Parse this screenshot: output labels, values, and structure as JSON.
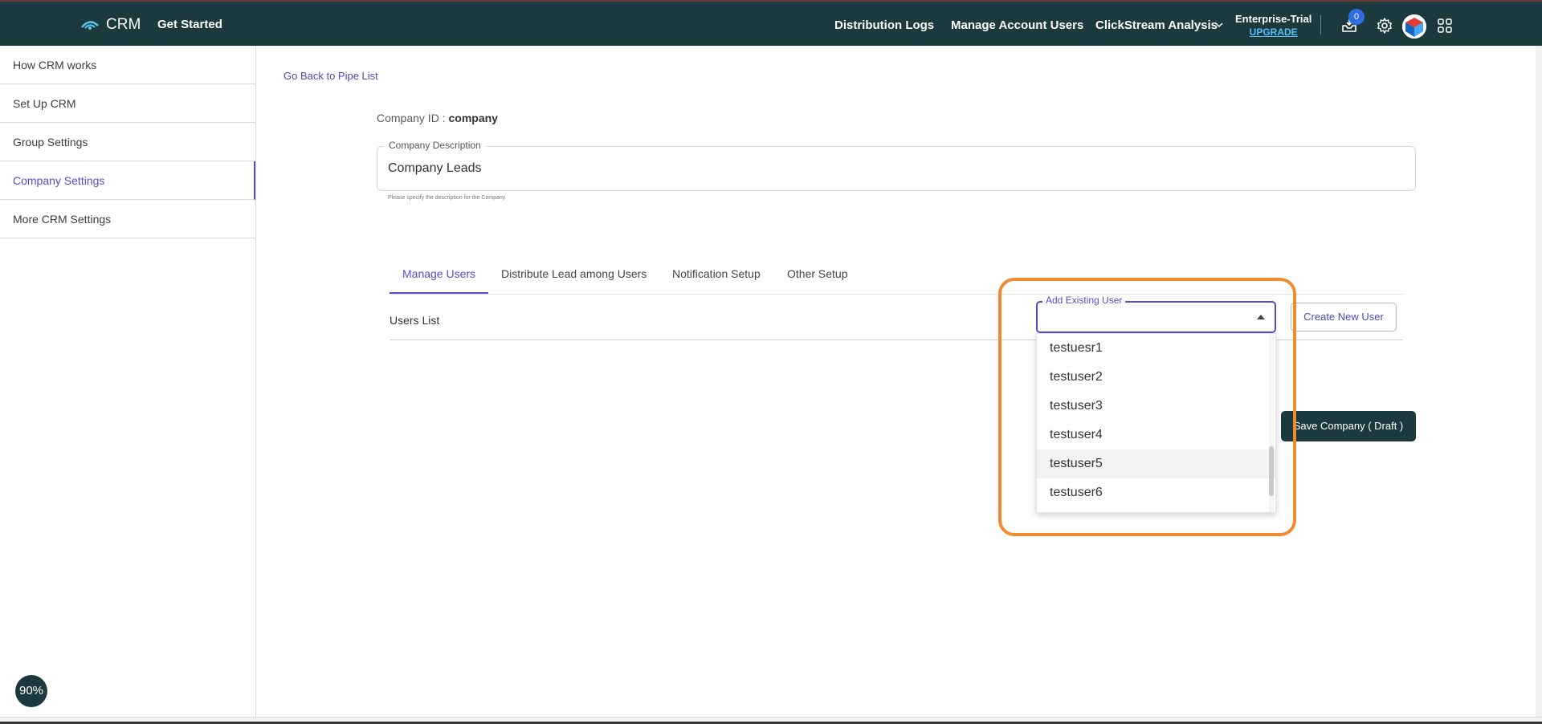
{
  "header": {
    "brand": "CRM",
    "get_started": "Get Started",
    "nav": [
      "Distribution Logs",
      "Manage Account Users",
      "ClickStream Analysis"
    ],
    "plan": "Enterprise-Trial",
    "upgrade": "UPGRADE",
    "notification_count": "0"
  },
  "sidebar": {
    "items": [
      {
        "label": "How CRM works"
      },
      {
        "label": "Set Up CRM"
      },
      {
        "label": "Group Settings"
      },
      {
        "label": "Company Settings"
      },
      {
        "label": "More CRM Settings"
      }
    ]
  },
  "main": {
    "back_link": "Go Back to Pipe List",
    "company_id_label": "Company ID : ",
    "company_id_value": "company",
    "description_label": "Company Description",
    "description_value": "Company Leads",
    "description_help": "Please specify the description for the Company",
    "tabs": [
      {
        "label": "Manage Users"
      },
      {
        "label": "Distribute Lead among Users"
      },
      {
        "label": "Notification Setup"
      },
      {
        "label": "Other Setup"
      }
    ],
    "users_list_label": "Users List",
    "add_user_label": "Add Existing User",
    "create_user_label": "Create New User",
    "dropdown_options": [
      "testuesr1",
      "testuser2",
      "testuser3",
      "testuser4",
      "testuser5",
      "testuser6"
    ],
    "save_label": "Save Company ( Draft )"
  },
  "zoom": "90%",
  "colors": {
    "header_bg": "#1c3a3e",
    "accent": "#5b49c7",
    "highlight": "#f28a2e",
    "badge": "#2f6de0"
  }
}
